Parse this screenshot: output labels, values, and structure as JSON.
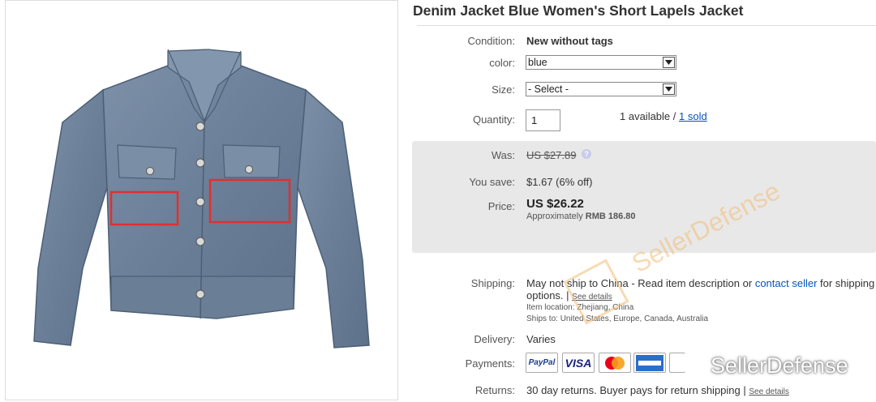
{
  "listing": {
    "title": "Denim Jacket Blue Women's Short Lapels Jacket"
  },
  "details": {
    "condition_label": "Condition:",
    "condition_value": "New without tags",
    "color_label": "color:",
    "color_value": "blue",
    "size_label": "Size:",
    "size_value": "- Select -",
    "quantity_label": "Quantity:",
    "quantity_value": "1",
    "available_text": "1 available / ",
    "sold_link": "1 sold"
  },
  "pricing": {
    "was_label": "Was:",
    "was_value": "US $27.89",
    "you_save_label": "You save:",
    "you_save_value": "$1.67 (6% off)",
    "price_label": "Price:",
    "price_value": "US $26.22",
    "approx_prefix": "Approximately",
    "approx_value": "RMB 186.80"
  },
  "shipping": {
    "label": "Shipping:",
    "text_before": "May not ship to China - Read item description or ",
    "contact_link": "contact seller",
    "text_after": " for shipping",
    "line2": "options. |",
    "see_details": "See details",
    "item_location_label": "Item location:",
    "item_location_value": "Zhejiang, China",
    "ships_to_label": "Ships to:",
    "ships_to_value": "United States, Europe, Canada, Australia"
  },
  "delivery": {
    "label": "Delivery:",
    "value": "Varies"
  },
  "payments": {
    "label": "Payments:",
    "methods": [
      "PayPal",
      "VISA",
      "MasterCard",
      "American Express"
    ]
  },
  "returns": {
    "label": "Returns:",
    "value": "30 day returns. Buyer pays for return shipping |",
    "see_details": "See details"
  },
  "watermark": {
    "diagonal": "SellerDefense",
    "bottom": "SellerDefense"
  },
  "colors": {
    "link": "#0654ba",
    "price_box": "#e8e8e8",
    "highlight_box": "#e03030"
  }
}
